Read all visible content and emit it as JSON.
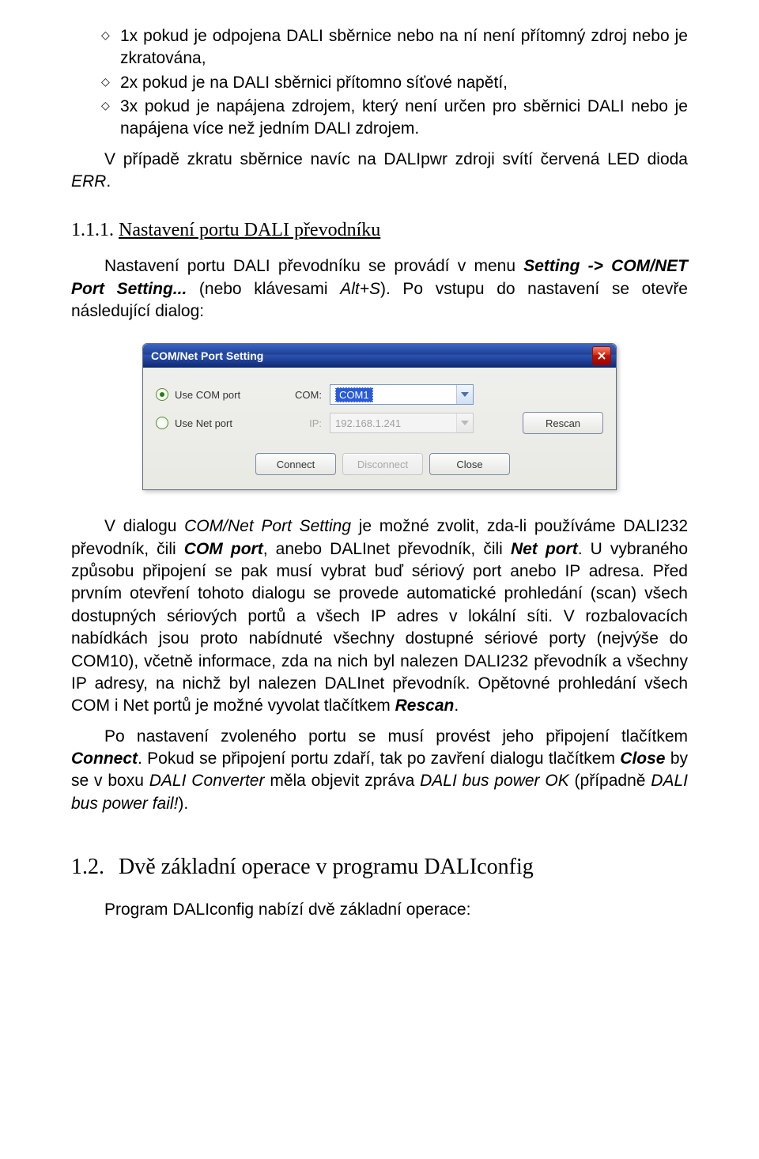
{
  "bullets": [
    "1x pokud je odpojena DALI  sběrnice nebo na ní není přítomný zdroj nebo je zkratována,",
    "2x pokud je na DALI sběrnici přítomno síťové napětí,",
    "3x pokud je napájena zdrojem, který není určen pro sběrnici DALI nebo je napájena více než jedním DALI zdrojem."
  ],
  "para_err_a": "V případě zkratu sběrnice navíc na DALIpwr zdroji svítí červená LED dioda ",
  "para_err_b": "ERR",
  "para_err_c": ".",
  "heading_111_num": "1.1.1.",
  "heading_111_title": "Nastavení portu DALI převodníku",
  "p2": {
    "a": "Nastavení portu DALI převodníku se provádí v menu ",
    "b": "Setting -> COM/NET Port Setting...",
    "c": " (nebo klávesami  ",
    "d": "Alt+S",
    "e": "). Po vstupu do nastavení se otevře následující dialog:"
  },
  "dialog": {
    "title": "COM/Net Port Setting",
    "close": "X",
    "radio_com": "Use COM port",
    "radio_net": "Use Net port",
    "label_com": "COM:",
    "label_ip": "IP:",
    "combo_com": "COM1",
    "combo_ip": "192.168.1.241",
    "btn_rescan": "Rescan",
    "btn_connect": "Connect",
    "btn_disconnect": "Disconnect",
    "btn_close": "Close"
  },
  "p3": {
    "a": "V dialogu ",
    "b": "COM/Net Port Setting",
    "c": " je možné zvolit, zda-li používáme DALI232 převodník, čili ",
    "d": "COM port",
    "e": ", anebo DALInet převodník, čili ",
    "f": "Net port",
    "g": ". U vybraného způsobu připojení se pak musí vybrat buď sériový port anebo IP adresa. Před prvním otevření tohoto dialogu se provede automatické prohledání (scan) všech dostupných sériových portů a všech IP adres v lokální síti.  V rozbalovacích nabídkách jsou proto nabídnuté všechny dostupné sériové porty (nejvýše do COM10), včetně informace, zda na nich byl nalezen DALI232 převodník a všechny IP adresy, na nichž byl nalezen DALInet převodník. Opětovné prohledání všech COM i Net portů je možné vyvolat tlačítkem ",
    "h": "Rescan",
    "i": "."
  },
  "p4": {
    "a": "Po nastavení zvoleného portu se musí provést jeho připojení tlačítkem ",
    "b": "Connect",
    "c": ". Pokud se připojení portu zdaří, tak po zavření dialogu tlačítkem ",
    "d": "Close",
    "e": " by se  v boxu ",
    "f": "DALI Converter",
    "g": " měla objevit zpráva ",
    "h": "DALI bus power OK",
    "i": " (případně ",
    "j": "DALI bus power fail!",
    "k": ")."
  },
  "heading_12_num": "1.2.",
  "heading_12_title": "Dvě základní operace v programu DALIconfig",
  "p5": "Program DALIconfig nabízí dvě základní operace:"
}
